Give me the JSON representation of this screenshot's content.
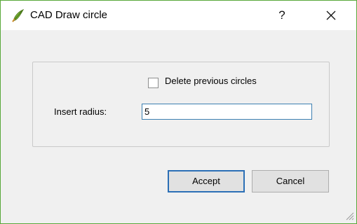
{
  "window": {
    "title": "CAD Draw circle",
    "help_label": "?",
    "icon": "qgis-logo-icon"
  },
  "options": {
    "delete_previous_label": "Delete previous circles",
    "delete_previous_checked": false
  },
  "radius": {
    "label": "Insert radius:",
    "value": "5"
  },
  "buttons": {
    "accept_label": "Accept",
    "cancel_label": "Cancel"
  },
  "colors": {
    "window_border": "#59a83a",
    "focus_accent": "#3c7fb1"
  }
}
